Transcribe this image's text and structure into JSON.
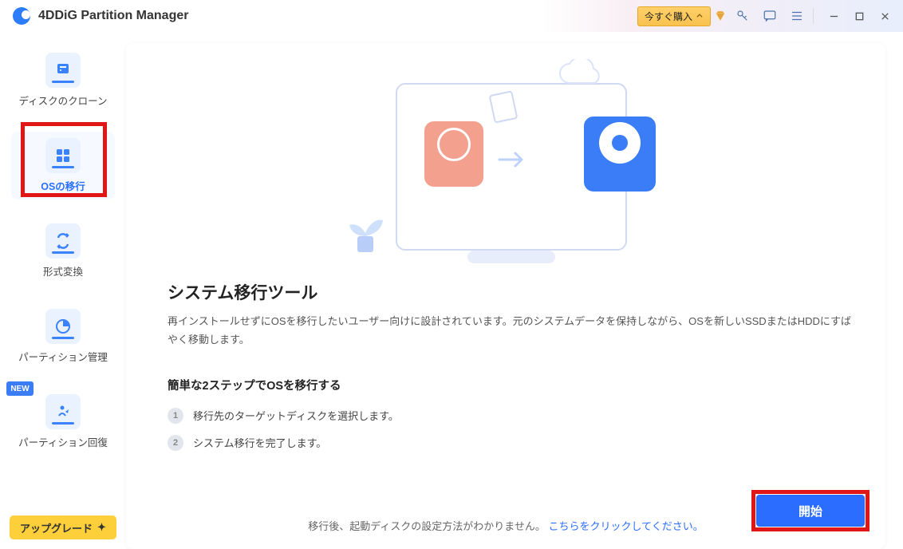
{
  "app_title": "4DDiG Partition Manager",
  "titlebar": {
    "buy_now": "今すぐ購入"
  },
  "sidebar": {
    "items": [
      {
        "label": "ディスクのクローン"
      },
      {
        "label": "OSの移行"
      },
      {
        "label": "形式変換"
      },
      {
        "label": "パーティション管理"
      },
      {
        "label": "パーティション回復"
      }
    ],
    "new_badge": "NEW",
    "upgrade": "アップグレード"
  },
  "main": {
    "title": "システム移行ツール",
    "desc": "再インストールせずにOSを移行したいユーザー向けに設計されています。元のシステムデータを保持しながら、OSを新しいSSDまたはHDDにすばやく移動します。",
    "sub_title": "簡単な2ステップでOSを移行する",
    "steps": [
      {
        "num": "1",
        "text": "移行先のターゲットディスクを選択します。"
      },
      {
        "num": "2",
        "text": "システム移行を完了します。"
      }
    ],
    "start": "開始",
    "footer_hint": "移行後、起動ディスクの設定方法がわかりません。",
    "footer_link": "こちらをクリックしてください。"
  }
}
